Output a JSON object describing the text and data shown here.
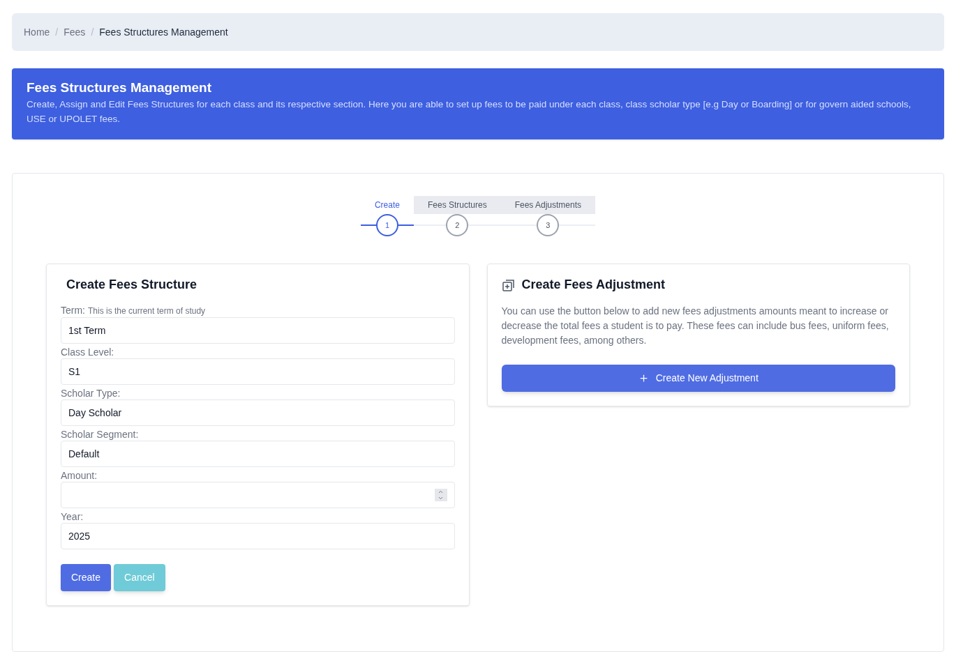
{
  "breadcrumb_separator": "/",
  "breadcrumb": [
    {
      "label": "Home",
      "current": false
    },
    {
      "label": "Fees",
      "current": false
    },
    {
      "label": "Fees Structures Management",
      "current": true
    }
  ],
  "banner": {
    "title": "Fees Structures Management",
    "description": "Create, Assign and Edit Fees Structures for each class and its respective section. Here you are able to set up fees to be paid under each class, class scholar type [e.g Day or Boarding] or for govern aided schools, USE or UPOLET fees."
  },
  "steps": [
    {
      "label": "Create",
      "number": "1",
      "selected": true
    },
    {
      "label": "Fees Structures",
      "number": "2",
      "selected": false
    },
    {
      "label": "Fees Adjustments",
      "number": "3",
      "selected": false
    }
  ],
  "form": {
    "title": "Create Fees Structure",
    "fields": [
      {
        "label": "Term:",
        "hint": "This is the current term of study",
        "value": "1st Term",
        "kind": "text"
      },
      {
        "label": "Class Level:",
        "value": "S1",
        "kind": "text"
      },
      {
        "label": "Scholar Type:",
        "value": "Day Scholar",
        "kind": "text"
      },
      {
        "label": "Scholar Segment:",
        "value": "Default",
        "kind": "text"
      },
      {
        "label": "Amount:",
        "kind": "number"
      },
      {
        "label": "Year:",
        "value": "2025",
        "kind": "text"
      }
    ],
    "buttons": [
      {
        "label": "Create",
        "kind": "primary"
      },
      {
        "label": "Cancel",
        "kind": "secondary"
      }
    ]
  },
  "adjustment": {
    "title": "Create Fees Adjustment",
    "description": "You can use the button below to add new fees adjustments amounts meant to increase or decrease the total fees a student is to pay. These fees can include bus fees, uniform fees, development fees, among others.",
    "button": "Create New Adjustment"
  }
}
